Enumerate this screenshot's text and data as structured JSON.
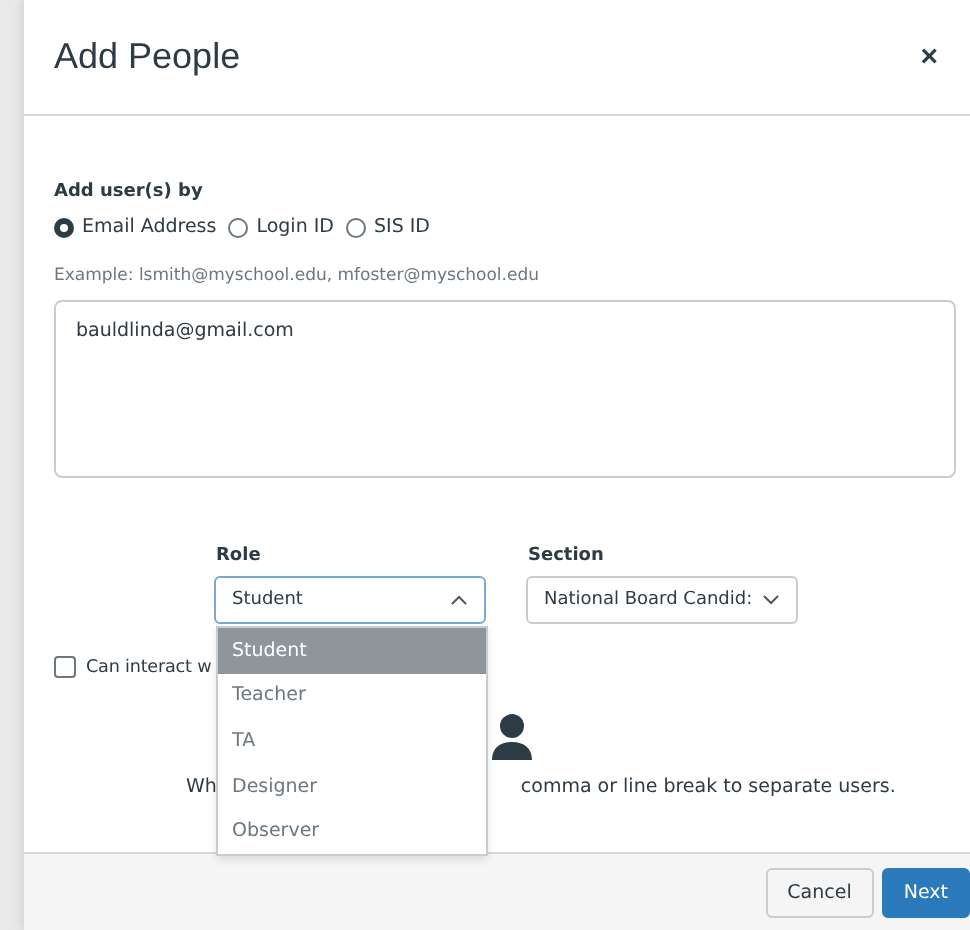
{
  "dialog": {
    "title": "Add People",
    "close": "×"
  },
  "add_by": {
    "label": "Add user(s) by",
    "options": [
      {
        "label": "Email Address",
        "selected": true
      },
      {
        "label": "Login ID",
        "selected": false
      },
      {
        "label": "SIS ID",
        "selected": false
      }
    ]
  },
  "example": "Example: lsmith@myschool.edu, mfoster@myschool.edu",
  "users_field": {
    "value": "bauldlinda@gmail.com"
  },
  "role": {
    "label": "Role",
    "value": "Student",
    "expanded": true,
    "options": [
      {
        "label": "Student",
        "selected": true
      },
      {
        "label": "Teacher",
        "selected": false
      },
      {
        "label": "TA",
        "selected": false
      },
      {
        "label": "Designer",
        "selected": false
      },
      {
        "label": "Observer",
        "selected": false
      }
    ]
  },
  "section": {
    "label": "Section",
    "value": "National Board Candid:"
  },
  "interact": {
    "label": "Can interact w",
    "checked": false
  },
  "hint": {
    "before": "Wh",
    "after": "comma or line break to separate users."
  },
  "buttons": [
    {
      "label": "Cancel",
      "kind": "secondary"
    },
    {
      "label": "Next",
      "kind": "primary"
    }
  ]
}
